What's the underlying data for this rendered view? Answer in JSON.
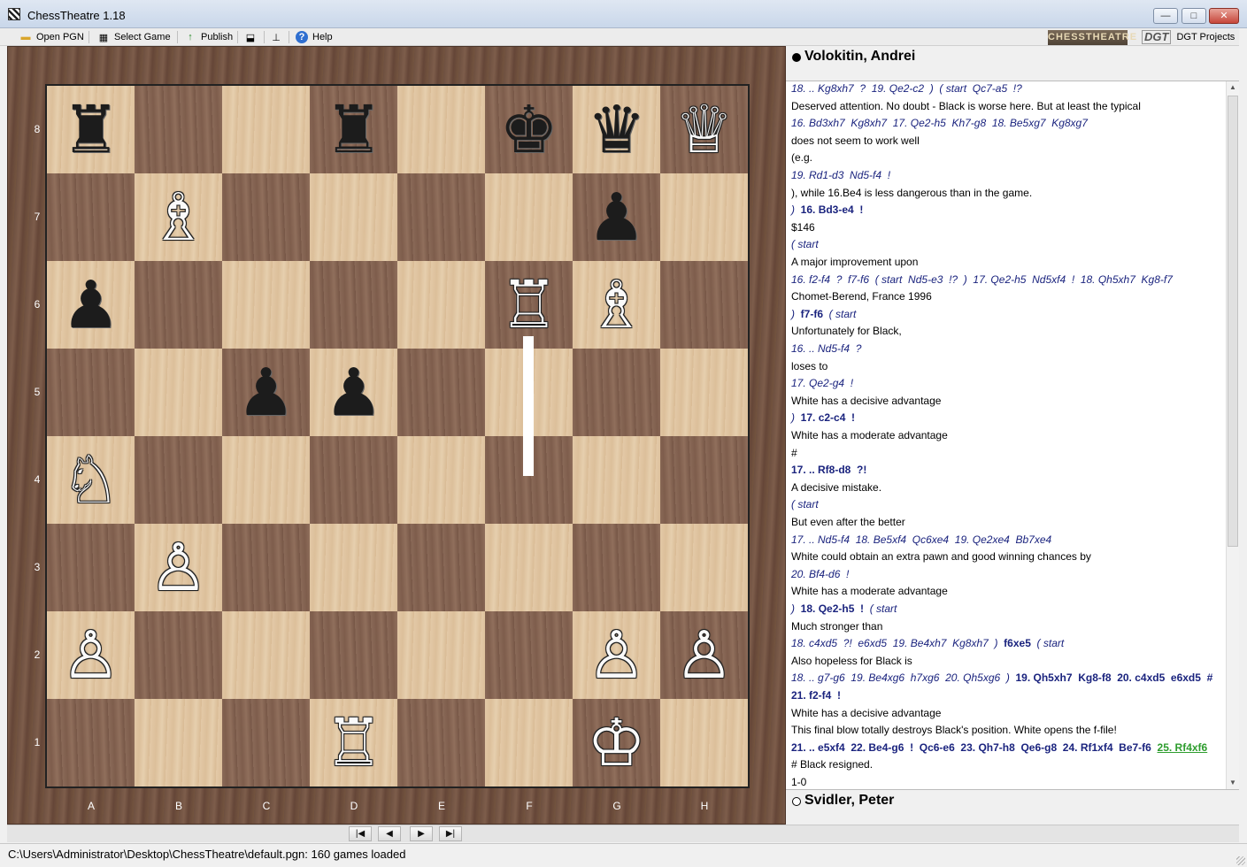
{
  "window": {
    "title": "ChessTheatre 1.18",
    "minimize": "—",
    "maximize": "□",
    "close": "✕"
  },
  "toolbar": {
    "open_pgn": "Open PGN",
    "select_game": "Select Game",
    "publish": "Publish",
    "help": "Help",
    "brand": "CHESSTHEATRE",
    "dgt_logo": "DGT",
    "dgt_projects": "DGT Projects"
  },
  "players": {
    "black": "Volokitin, Andrei",
    "white": "Svidler, Peter"
  },
  "board": {
    "files": [
      "A",
      "B",
      "C",
      "D",
      "E",
      "F",
      "G",
      "H"
    ],
    "ranks": [
      "8",
      "7",
      "6",
      "5",
      "4",
      "3",
      "2",
      "1"
    ],
    "squares": [
      [
        "♜",
        "",
        "",
        "♜",
        "",
        "♚",
        "♛",
        "♕"
      ],
      [
        "",
        "♗",
        "",
        "",
        "",
        "",
        "♟",
        ""
      ],
      [
        "♟",
        "",
        "",
        "",
        "",
        "♖",
        "♗",
        ""
      ],
      [
        "",
        "",
        "♟",
        "♟",
        "",
        "",
        "",
        ""
      ],
      [
        "♘",
        "",
        "",
        "",
        "",
        "",
        "",
        ""
      ],
      [
        "",
        "♙",
        "",
        "",
        "",
        "",
        "",
        ""
      ],
      [
        "♙",
        "",
        "",
        "",
        "",
        "",
        "♙",
        "♙"
      ],
      [
        "",
        "",
        "",
        "♖",
        "",
        "",
        "♔",
        ""
      ]
    ],
    "colors": [
      [
        "b",
        "",
        "",
        "b",
        "",
        "b",
        "b",
        "w"
      ],
      [
        "",
        "w",
        "",
        "",
        "",
        "",
        "b",
        ""
      ],
      [
        "b",
        "",
        "",
        "",
        "",
        "w",
        "w",
        ""
      ],
      [
        "",
        "",
        "b",
        "b",
        "",
        "",
        "",
        ""
      ],
      [
        "w",
        "",
        "",
        "",
        "",
        "",
        "",
        ""
      ],
      [
        "",
        "w",
        "",
        "",
        "",
        "",
        "",
        ""
      ],
      [
        "w",
        "",
        "",
        "",
        "",
        "",
        "w",
        "w"
      ],
      [
        "",
        "",
        "",
        "w",
        "",
        "",
        "w",
        ""
      ]
    ]
  },
  "moves": [
    [
      {
        "t": "18. .. Kg8xh7  ?  19. Qe2-c2  )  ( start  Qc7-a5  !?",
        "c": "mv"
      }
    ],
    [
      {
        "t": "Deserved attention. No doubt - Black is worse here. But at least the typical",
        "c": ""
      }
    ],
    [
      {
        "t": "16. Bd3xh7  Kg8xh7  17. Qe2-h5  Kh7-g8  18. Be5xg7  Kg8xg7",
        "c": "mv"
      }
    ],
    [
      {
        "t": "does not seem to work well",
        "c": ""
      }
    ],
    [
      {
        "t": "(e.g.",
        "c": ""
      }
    ],
    [
      {
        "t": "19. Rd1-d3  Nd5-f4  !",
        "c": "mv"
      }
    ],
    [
      {
        "t": "), while 16.Be4 is less dangerous than in the game.",
        "c": ""
      }
    ],
    [
      {
        "t": ")  ",
        "c": "mv"
      },
      {
        "t": "16. Bd3-e4  !",
        "c": "mvb"
      }
    ],
    [
      {
        "t": "$146",
        "c": ""
      }
    ],
    [
      {
        "t": "( start",
        "c": "mv"
      }
    ],
    [
      {
        "t": "A major improvement upon",
        "c": ""
      }
    ],
    [
      {
        "t": "16. f2-f4  ?  f7-f6  ( start  Nd5-e3  !?  )  17. Qe2-h5  Nd5xf4  !  18. Qh5xh7  Kg8-f7",
        "c": "mv"
      }
    ],
    [
      {
        "t": "Chomet-Berend, France 1996",
        "c": ""
      }
    ],
    [
      {
        "t": ")  ",
        "c": "mv"
      },
      {
        "t": "f7-f6",
        "c": "mvb"
      },
      {
        "t": "  ( start",
        "c": "mv"
      }
    ],
    [
      {
        "t": "Unfortunately for Black,",
        "c": ""
      }
    ],
    [
      {
        "t": "16. .. Nd5-f4  ?",
        "c": "mv"
      }
    ],
    [
      {
        "t": "loses to",
        "c": ""
      }
    ],
    [
      {
        "t": "17. Qe2-g4  !",
        "c": "mv"
      }
    ],
    [
      {
        "t": "White has a decisive advantage",
        "c": ""
      }
    ],
    [
      {
        "t": ")  ",
        "c": "mv"
      },
      {
        "t": "17. c2-c4  !",
        "c": "mvb"
      }
    ],
    [
      {
        "t": "White has a moderate advantage",
        "c": ""
      }
    ],
    [
      {
        "t": "#",
        "c": ""
      }
    ],
    [
      {
        "t": "17. .. Rf8-d8  ?!",
        "c": "mvb"
      }
    ],
    [
      {
        "t": "A decisive mistake.",
        "c": ""
      }
    ],
    [
      {
        "t": "( start",
        "c": "mv"
      }
    ],
    [
      {
        "t": "But even after the better",
        "c": ""
      }
    ],
    [
      {
        "t": "17. .. Nd5-f4  18. Be5xf4  Qc6xe4  19. Qe2xe4  Bb7xe4",
        "c": "mv"
      }
    ],
    [
      {
        "t": "White could obtain an extra pawn and good winning chances by",
        "c": ""
      }
    ],
    [
      {
        "t": "20. Bf4-d6  !",
        "c": "mv"
      }
    ],
    [
      {
        "t": "White has a moderate advantage",
        "c": ""
      }
    ],
    [
      {
        "t": ")  ",
        "c": "mv"
      },
      {
        "t": "18. Qe2-h5  !",
        "c": "mvb"
      },
      {
        "t": "  ( start",
        "c": "mv"
      }
    ],
    [
      {
        "t": "Much stronger than",
        "c": ""
      }
    ],
    [
      {
        "t": "18. c4xd5  ?!  e6xd5  19. Be4xh7  Kg8xh7  )  ",
        "c": "mv"
      },
      {
        "t": "f6xe5",
        "c": "mvb"
      },
      {
        "t": "  ( start",
        "c": "mv"
      }
    ],
    [
      {
        "t": "Also hopeless for Black is",
        "c": ""
      }
    ],
    [
      {
        "t": "18. .. g7-g6  19. Be4xg6  h7xg6  20. Qh5xg6  )  ",
        "c": "mv"
      },
      {
        "t": "19. Qh5xh7  Kg8-f8  20. c4xd5  e6xd5  #",
        "c": "mvb"
      }
    ],
    [
      {
        "t": "21. f2-f4  !",
        "c": "mvb"
      }
    ],
    [
      {
        "t": "White has a decisive advantage",
        "c": ""
      }
    ],
    [
      {
        "t": "This final blow totally destroys Black's position. White opens the f-file!",
        "c": ""
      }
    ],
    [
      {
        "t": "21. .. e5xf4  22. Be4-g6  !  Qc6-e6  23. Qh7-h8  Qe6-g8  24. Rf1xf4  Be7-f6  ",
        "c": "mvb"
      },
      {
        "t": "25. Rf4xf6",
        "c": "cur"
      }
    ],
    [
      {
        "t": "# Black resigned.",
        "c": ""
      }
    ],
    [
      {
        "t": "1-0",
        "c": ""
      }
    ]
  ],
  "nav": {
    "first": "|◀",
    "prev": "◀",
    "next": "▶",
    "last": "▶|"
  },
  "status": "C:\\Users\\Administrator\\Desktop\\ChessTheatre\\default.pgn: 160 games loaded",
  "colors": {
    "move_text": "#1a237e",
    "current_move": "#2e9d2e"
  }
}
